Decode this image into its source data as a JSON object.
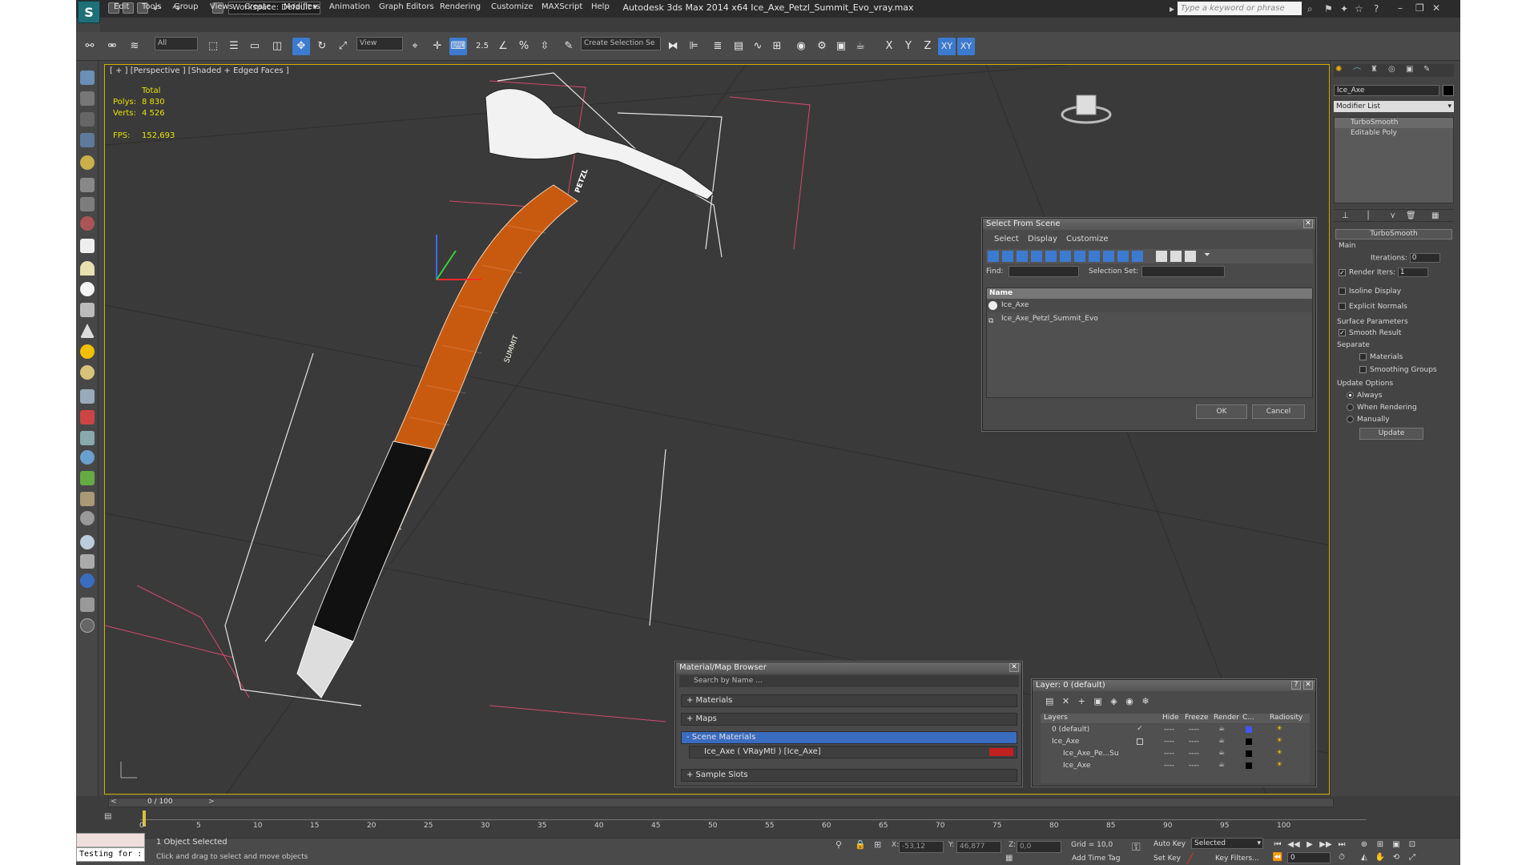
{
  "titlebar": {
    "workspace": "Workspace: Default",
    "title": "Autodesk 3ds Max  2014 x64      Ice_Axe_Petzl_Summit_Evo_vray.max",
    "search_placeholder": "Type a keyword or phrase"
  },
  "menu": [
    "Edit",
    "Tools",
    "Group",
    "Views",
    "Create",
    "Modifiers",
    "Animation",
    "Graph Editors",
    "Rendering",
    "Customize",
    "MAXScript",
    "Help"
  ],
  "toolbar": {
    "selection_filter": "All",
    "ref_coord": "View",
    "snap_value": "2.5",
    "selection_set": "Create Selection Se",
    "axis_x": "X",
    "axis_y": "Y",
    "axis_z": "Z",
    "axis_xy": "XY",
    "axis_xy2": "XY"
  },
  "viewport": {
    "label": "[ + ] [Perspective ] [Shaded + Edged Faces ]",
    "stats_header": "Total",
    "polys_label": "Polys:",
    "polys_value": "8 830",
    "verts_label": "Verts:",
    "verts_value": "4 526",
    "fps_label": "FPS:",
    "fps_value": "152,693",
    "mesh_label_1": "PETZL",
    "mesh_label_2": "SUMMIT"
  },
  "command_panel": {
    "object_name": "Ice_Axe",
    "modifier_list": "Modifier List",
    "stack": [
      "TurboSmooth",
      "Editable Poly"
    ],
    "rollout_title": "TurboSmooth",
    "main_group": "Main",
    "iterations_label": "Iterations:",
    "iterations_value": "0",
    "render_iters_label": "Render Iters:",
    "render_iters_value": "1",
    "isoline_display": "Isoline Display",
    "explicit_normals": "Explicit Normals",
    "surface_params": "Surface Parameters",
    "smooth_result": "Smooth Result",
    "separate": "Separate",
    "materials": "Materials",
    "smoothing_groups": "Smoothing Groups",
    "update_options": "Update Options",
    "always": "Always",
    "when_rendering": "When Rendering",
    "manually": "Manually",
    "update_btn": "Update"
  },
  "select_from_scene": {
    "title": "Select From Scene",
    "menu": [
      "Select",
      "Display",
      "Customize"
    ],
    "find_label": "Find:",
    "selection_set_label": "Selection Set:",
    "column_name": "Name",
    "rows": [
      "Ice_Axe",
      "Ice_Axe_Petzl_Summit_Evo"
    ],
    "ok": "OK",
    "cancel": "Cancel"
  },
  "material_browser": {
    "title": "Material/Map Browser",
    "search_placeholder": "Search by Name ...",
    "sections": [
      "+ Materials",
      "+ Maps",
      "- Scene Materials"
    ],
    "scene_material": "Ice_Axe  ( VRayMtl )  [Ice_Axe]",
    "sample_slots": "+ Sample Slots"
  },
  "layer_dialog": {
    "title": "Layer: 0 (default)",
    "columns": [
      "Layers",
      "Hide",
      "Freeze",
      "Render",
      "C...",
      "Radiosity"
    ],
    "rows": [
      "0 (default)",
      "Ice_Axe",
      "Ice_Axe_Pe...Su",
      "Ice_Axe"
    ],
    "hide_marker": "----",
    "freeze_marker": "----",
    "help": "?"
  },
  "timeline": {
    "frame_display": "0 / 100",
    "ticks": [
      "0",
      "5",
      "10",
      "15",
      "20",
      "25",
      "30",
      "35",
      "40",
      "45",
      "50",
      "55",
      "60",
      "65",
      "70",
      "75",
      "80",
      "85",
      "90",
      "95",
      "100"
    ]
  },
  "status": {
    "maxscript": "Testing for :",
    "selected": "1 Object Selected",
    "prompt": "Click and drag to select and move objects",
    "x_label": "X:",
    "x_value": "-53,12",
    "y_label": "Y:",
    "y_value": "46,877",
    "z_label": "Z:",
    "z_value": "0,0",
    "grid": "Grid = 10,0",
    "auto_key": "Auto Key",
    "set_key": "Set Key",
    "key_mode": "Selected",
    "key_filters": "Key Filters...",
    "add_time_tag": "Add Time Tag",
    "frame_field": "0"
  },
  "colors": {
    "accent_blue": "#3c7bd0",
    "viewport_border": "#d0b000",
    "stats_yellow": "#e8e300",
    "handle_orange": "#c85a10"
  }
}
